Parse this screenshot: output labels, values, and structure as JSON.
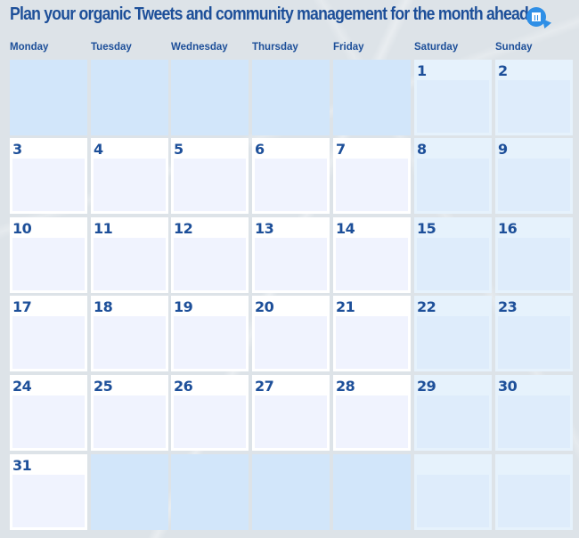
{
  "header": {
    "title": "Plan your organic Tweets and community management for the month ahead",
    "icon": "calendar-cursor-icon"
  },
  "colors": {
    "title": "#1d4f99",
    "icon_bg": "#2f8fe6",
    "empty_cell": "#d2e6fa",
    "weekday_cell": "#ffffff",
    "weekday_note": "#f0f3fe",
    "weekend_cell": "#e6f2fc",
    "weekend_note": "#deecfb",
    "background": "#dde3e8"
  },
  "weekdays": [
    "Monday",
    "Tuesday",
    "Wednesday",
    "Thursday",
    "Friday",
    "Saturday",
    "Sunday"
  ],
  "weeks": [
    [
      "",
      "",
      "",
      "",
      "",
      "1",
      "2"
    ],
    [
      "3",
      "4",
      "5",
      "6",
      "7",
      "8",
      "9"
    ],
    [
      "10",
      "11",
      "12",
      "13",
      "14",
      "15",
      "16"
    ],
    [
      "17",
      "18",
      "19",
      "20",
      "21",
      "22",
      "23"
    ],
    [
      "24",
      "25",
      "26",
      "27",
      "28",
      "29",
      "30"
    ],
    [
      "31",
      "",
      "",
      "",
      "",
      "",
      ""
    ]
  ]
}
